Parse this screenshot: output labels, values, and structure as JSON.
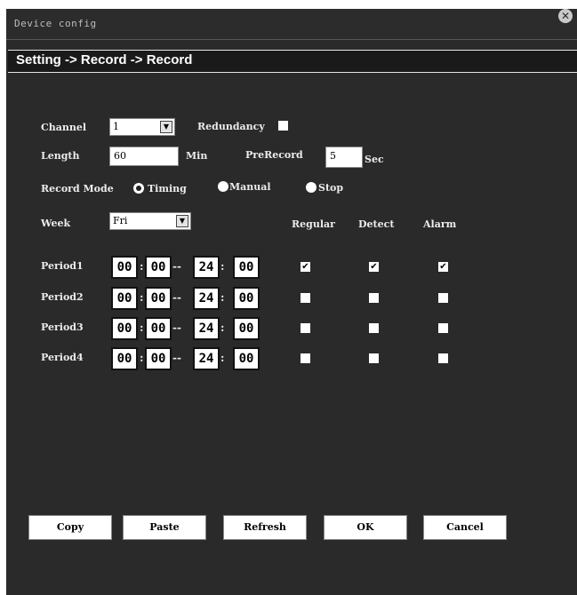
{
  "window": {
    "title": "Device config",
    "close_icon": "close-icon"
  },
  "breadcrumb": "Setting -> Record -> Record",
  "channel": {
    "label": "Channel",
    "value": "1"
  },
  "redundancy": {
    "label": "Redundancy",
    "checked": false
  },
  "length": {
    "label": "Length",
    "value": "60",
    "unit": "Min"
  },
  "prerecord": {
    "label": "PreRecord",
    "value": "5",
    "unit": "Sec"
  },
  "record_mode": {
    "label": "Record Mode",
    "options": [
      {
        "label": "Timing",
        "selected": true
      },
      {
        "label": "Manual",
        "selected": false
      },
      {
        "label": "Stop",
        "selected": false
      }
    ]
  },
  "week": {
    "label": "Week",
    "value": "Fri"
  },
  "columns": {
    "regular": "Regular",
    "detect": "Detect",
    "alarm": "Alarm"
  },
  "periods": [
    {
      "label": "Period1",
      "start_h": "00",
      "start_m": "00",
      "end_h": "24",
      "end_m": "00",
      "regular": true,
      "detect": true,
      "alarm": true
    },
    {
      "label": "Period2",
      "start_h": "00",
      "start_m": "00",
      "end_h": "24",
      "end_m": "00",
      "regular": false,
      "detect": false,
      "alarm": false
    },
    {
      "label": "Period3",
      "start_h": "00",
      "start_m": "00",
      "end_h": "24",
      "end_m": "00",
      "regular": false,
      "detect": false,
      "alarm": false
    },
    {
      "label": "Period4",
      "start_h": "00",
      "start_m": "00",
      "end_h": "24",
      "end_m": "00",
      "regular": false,
      "detect": false,
      "alarm": false
    }
  ],
  "buttons": {
    "copy": "Copy",
    "paste": "Paste",
    "refresh": "Refresh",
    "ok": "OK",
    "cancel": "Cancel"
  },
  "colors": {
    "panel": "#2a2a2a",
    "breadcrumb_bg": "#1a1a1a",
    "text": "#ececec"
  }
}
